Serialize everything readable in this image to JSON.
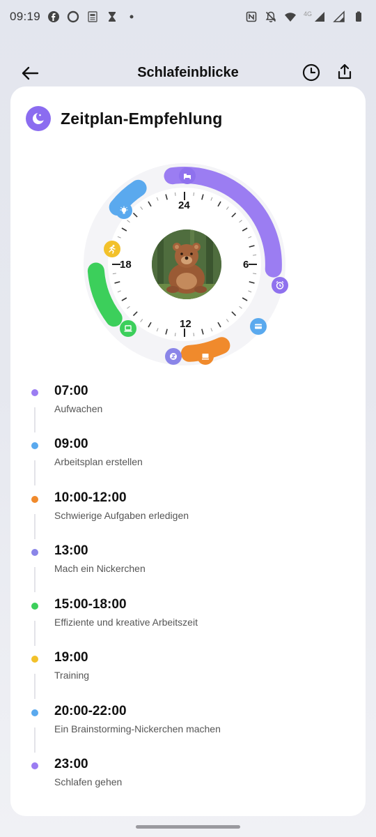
{
  "status_bar": {
    "time": "09:19",
    "network_label": "4G",
    "left_icons": [
      "facebook-icon",
      "circle-app-icon",
      "news-icon",
      "hourglass-icon",
      "dot-icon"
    ],
    "right_icons": [
      "nfc-icon",
      "bell-off-icon",
      "wifi-icon",
      "signal-icon",
      "signal-icon",
      "battery-icon"
    ]
  },
  "header": {
    "title": "Schlafeinblicke",
    "back_icon": "arrow-left-icon",
    "history_icon": "clock-icon",
    "share_icon": "share-icon"
  },
  "card": {
    "title": "Zeitplan-Empfehlung",
    "icon": "moon-icon"
  },
  "clock": {
    "labels": {
      "top": "24",
      "right": "6",
      "bottom": "12",
      "left": "18"
    },
    "avatar": "bear-avatar",
    "colors": {
      "purple": "#9b7df2",
      "blue": "#5aa9ee",
      "orange": "#f08a2c",
      "green": "#3ccf5b",
      "yellow": "#f2c12a",
      "violet_dot": "#8a85e8"
    }
  },
  "timeline": [
    {
      "time": "07:00",
      "label": "Aufwachen",
      "color": "#9b7df2"
    },
    {
      "time": "09:00",
      "label": "Arbeitsplan erstellen",
      "color": "#5aa9ee"
    },
    {
      "time": "10:00-12:00",
      "label": "Schwierige Aufgaben erledigen",
      "color": "#f08a2c"
    },
    {
      "time": "13:00",
      "label": "Mach ein Nickerchen",
      "color": "#8a85e8"
    },
    {
      "time": "15:00-18:00",
      "label": "Effiziente und kreative Arbeitszeit",
      "color": "#3ccf5b"
    },
    {
      "time": "19:00",
      "label": "Training",
      "color": "#f2c12a"
    },
    {
      "time": "20:00-22:00",
      "label": "Ein Brainstorming-Nickerchen machen",
      "color": "#5aa9ee"
    },
    {
      "time": "23:00",
      "label": "Schlafen gehen",
      "color": "#9b7df2"
    }
  ]
}
